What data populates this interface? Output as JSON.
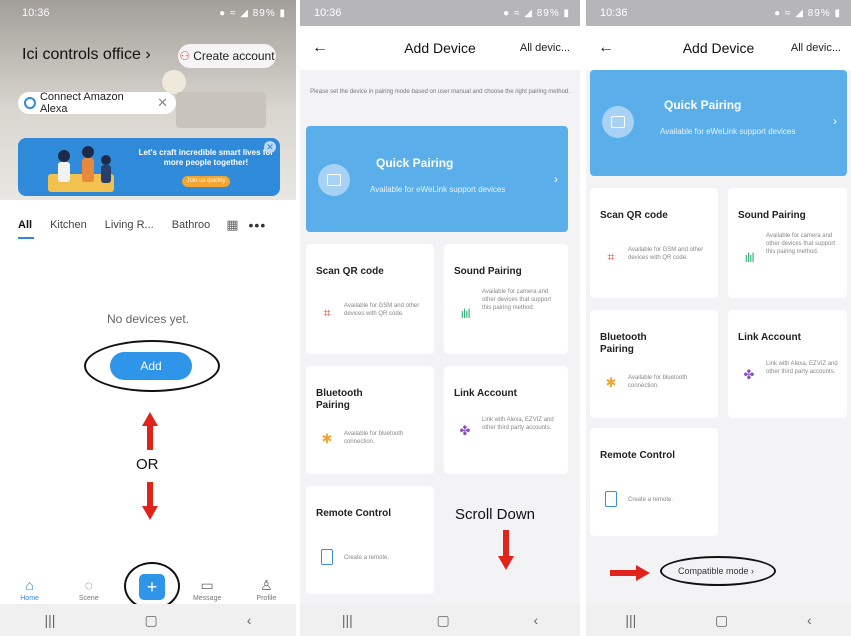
{
  "screen1": {
    "status_time": "10:36",
    "status_right": "89%",
    "home_title": "Ici controls office ›",
    "create_account": "Create account",
    "alexa_chip": "Connect Amazon Alexa",
    "banner_text": "Let's craft incredible smart lives for more people together!",
    "banner_button": "Join us quickly",
    "categories": [
      "All",
      "Kitchen",
      "Living R...",
      "Bathroo"
    ],
    "empty_text": "No devices yet.",
    "add_button": "Add",
    "or_text": "OR",
    "tabs": [
      "Home",
      "Scene",
      "Message",
      "Profile"
    ]
  },
  "add_device": {
    "status_time": "10:36",
    "status_right": "89%",
    "title": "Add Device",
    "right": "All devic...",
    "hint": "Please set the device in pairing mode based on user manual and choose the right pairing method.",
    "quick_pairing_title": "Quick Pairing",
    "quick_pairing_sub": "Available for eWeLink support devices",
    "scan_title": "Scan QR code",
    "scan_desc": "Available for GSM and other devices with QR code.",
    "sound_title": "Sound Pairing",
    "sound_desc": "Available for camera and other devices that support this pairing method.",
    "bt_title": "Bluetooth Pairing",
    "bt_desc": "Available for bluetooth connection.",
    "link_title": "Link Account",
    "link_desc": "Link with Alexa, EZVIZ and other third party accounts.",
    "remote_title": "Remote Control",
    "remote_desc": "Create a remote.",
    "scroll_text": "Scroll Down",
    "compat_text": "Compatible mode ›"
  },
  "colors": {
    "accent": "#2f95e8",
    "quick_pairing": "#5aaeea",
    "annotation_arrow": "#e0241b"
  },
  "icons": [
    "back-arrow-icon",
    "qr-scan-icon",
    "sound-wave-icon",
    "bluetooth-icon",
    "link-account-icon",
    "remote-icon",
    "home-icon",
    "scene-icon",
    "message-icon",
    "profile-icon",
    "plus-icon",
    "grid-icon",
    "more-icon"
  ]
}
